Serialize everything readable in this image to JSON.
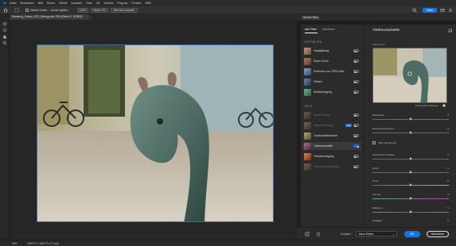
{
  "menubar": {
    "logo": "Ps",
    "items": [
      "Datei",
      "Bearbeiten",
      "Bild",
      "Ebene",
      "Schrift",
      "Auswahl",
      "Filter",
      "3D",
      "Ansicht",
      "Plug-ins",
      "Fenster",
      "Hilfe"
    ]
  },
  "options": {
    "checkbox_label": "Weiche Kante ... Kanten glätten",
    "pill1": "100%",
    "pill2": "Fläche: BG",
    "pill3": "Bild einer Auswahl",
    "share": "Teilen"
  },
  "document": {
    "tab_title": "Samsung_Galaxy_S22_Ultra.jpg bei 25% (Ebene 0, RGB/8) *",
    "zoom": "25%",
    "info": "3000 Px x 3000 Px (72 ppi)"
  },
  "neural_filters": {
    "header_tab": "Neural Filters",
    "tabs": [
      "Alle Filter",
      "Warteliste"
    ],
    "sections": {
      "enthalten": "ENTHALTEN",
      "beta": "BETA"
    },
    "included": [
      "Hautglättung",
      "Super Zoom",
      "Entfernen von JPEG-Arte...",
      "Färben",
      "Stilübertragung"
    ],
    "beta": [
      "Smart Porträt",
      "Harmonisierung",
      "Landschaftsmischer",
      "Tiefenunschärfe",
      "Farbübertragung",
      "Makeup-Übertragung"
    ],
    "beta_badge": "Neu",
    "selected_filter": "Tiefenunschärfe"
  },
  "settings": {
    "title": "Tiefenunschärfe",
    "preview_label": "Fokuspunkt",
    "focus_remove": "Fokuspunkt entfernen",
    "sliders": [
      {
        "label": "Brennweite",
        "value": "0",
        "pct": 0.5
      },
      {
        "label": "Brennweitenbereich",
        "value": "0",
        "pct": 0.5
      }
    ],
    "checkbox": "Motiv fokussieren",
    "sliders2": [
      {
        "label": "Weichzeichnerstärke",
        "value": "0",
        "pct": 0.5
      },
      {
        "label": "Dunst",
        "value": "0",
        "pct": 0.5
      },
      {
        "label": "Temp",
        "value": "0",
        "pct": 0.5
      },
      {
        "label": "Tönung",
        "value": "0",
        "pct": 0.5
      },
      {
        "label": "Sättigung",
        "value": "0",
        "pct": 0.5
      },
      {
        "label": "Helligkeit",
        "value": "0",
        "pct": 0.5
      }
    ]
  },
  "footer": {
    "output_label": "Ausgabe",
    "output_value": "Neue Ebene",
    "ok": "OK",
    "cancel": "Abbrechen"
  },
  "colors": {
    "accent": "#1473e6",
    "panel": "#2b2b2b",
    "canvas_bg": "#262626"
  }
}
